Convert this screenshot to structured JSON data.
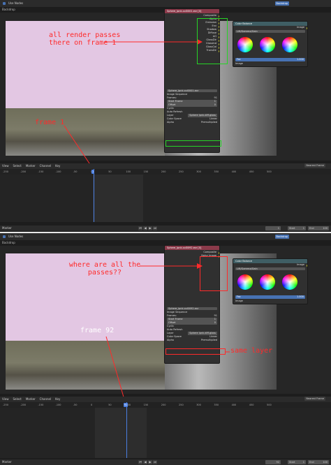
{
  "top": {
    "header": {
      "use_nodes": "Use Nodes",
      "backdrop": "Backdrop"
    },
    "left_label": "Backdrop",
    "image_node": {
      "title": "Sphere_lpnk.col0001.exr [0]",
      "outputs": [
        "Composite",
        "Alpha",
        "Emission",
        "Env",
        "Shadow",
        "Diffuse",
        "AO",
        "GlossDir",
        "GlossInd",
        "GlossCol",
        "TransDir"
      ],
      "file": "Sphere_lpnk.col0001.exr",
      "source": "Image Sequence",
      "frames_label": "Frames:",
      "frames": "91",
      "start_frame_label": "Start Frame",
      "start_frame": "1",
      "offset_label": "Offset",
      "offset": "0",
      "cyclic": "Cyclic",
      "auto_refresh": "Auto Refresh",
      "layer_label": "Layer",
      "layer": "Sphere lpnk.diff.gloss",
      "color_space_label": "Color Space",
      "color_space": "Linear",
      "alpha_label": "Alpha",
      "alpha": "Premultiplied"
    },
    "cb_node": {
      "title": "Color Balance",
      "output": "Image",
      "mode": "Lift/Gamma/Gain",
      "wheels": [
        "Lift",
        "Gamma",
        "Gain"
      ],
      "fac_label": "Fac",
      "fac": "1.000",
      "input": "Image"
    },
    "annotation_passes": "all render passes\nthere on frame 1",
    "annotation_frame": "frame 1",
    "timeline": {
      "menus": [
        "View",
        "Select",
        "Marker",
        "Channel",
        "Key"
      ],
      "snap": "Nearest Frame",
      "ticks": [
        "-250",
        "-200",
        "-150",
        "-100",
        "-50",
        "0",
        "50",
        "100",
        "150",
        "200",
        "250",
        "300",
        "350",
        "400",
        "450",
        "500"
      ],
      "current_frame": "1",
      "footer": "Marker",
      "frame_field": "1",
      "start_label": "Start",
      "start": "1",
      "end_label": "End",
      "end": "100"
    }
  },
  "bottom": {
    "header": {
      "use_nodes": "Use Nodes",
      "backdrop": "Backdrop"
    },
    "left_label": "Backdrop",
    "image_node": {
      "title": "Sphere_lpnk.col0092.exr [0]",
      "outputs": [
        "Composite",
        "Noisy Image"
      ],
      "file": "Sphere_lpnk.col0092.exr",
      "source": "Image Sequence",
      "frames_label": "Frames:",
      "frames": "91",
      "start_frame_label": "Start Frame",
      "start_frame": "1",
      "offset_label": "Offset",
      "offset": "0",
      "cyclic": "Cyclic",
      "auto_refresh": "Auto Refresh",
      "layer_label": "Layer",
      "layer": "Sphere lpnk.diff.gloss",
      "color_space_label": "Color Space",
      "color_space": "Linear",
      "alpha_label": "Alpha",
      "alpha": "Premultiplied"
    },
    "cb_node": {
      "title": "Color Balance",
      "output": "Image",
      "mode": "Lift/Gamma/Gain",
      "wheels": [
        "Lift",
        "Gamma",
        "Gain"
      ],
      "fac_label": "Fac",
      "fac": "1.000",
      "input": "Image"
    },
    "annotation_passes": "where are all the\npasses??",
    "annotation_frame": "frame 92",
    "annotation_layer": "same layer",
    "timeline": {
      "menus": [
        "View",
        "Select",
        "Marker",
        "Channel",
        "Key"
      ],
      "snap": "Nearest Frame",
      "ticks": [
        "-250",
        "-200",
        "-150",
        "-100",
        "-50",
        "0",
        "50",
        "100",
        "150",
        "200",
        "250",
        "300",
        "350",
        "400",
        "450",
        "500"
      ],
      "current_frame": "92",
      "footer": "Marker",
      "frame_field": "92",
      "start_label": "Start",
      "start": "1",
      "end_label": "End",
      "end": "100"
    }
  },
  "colors": {
    "annotation": "#ff2a2a",
    "highlight_green": "#27d427",
    "playhead": "#4a7ee0"
  }
}
